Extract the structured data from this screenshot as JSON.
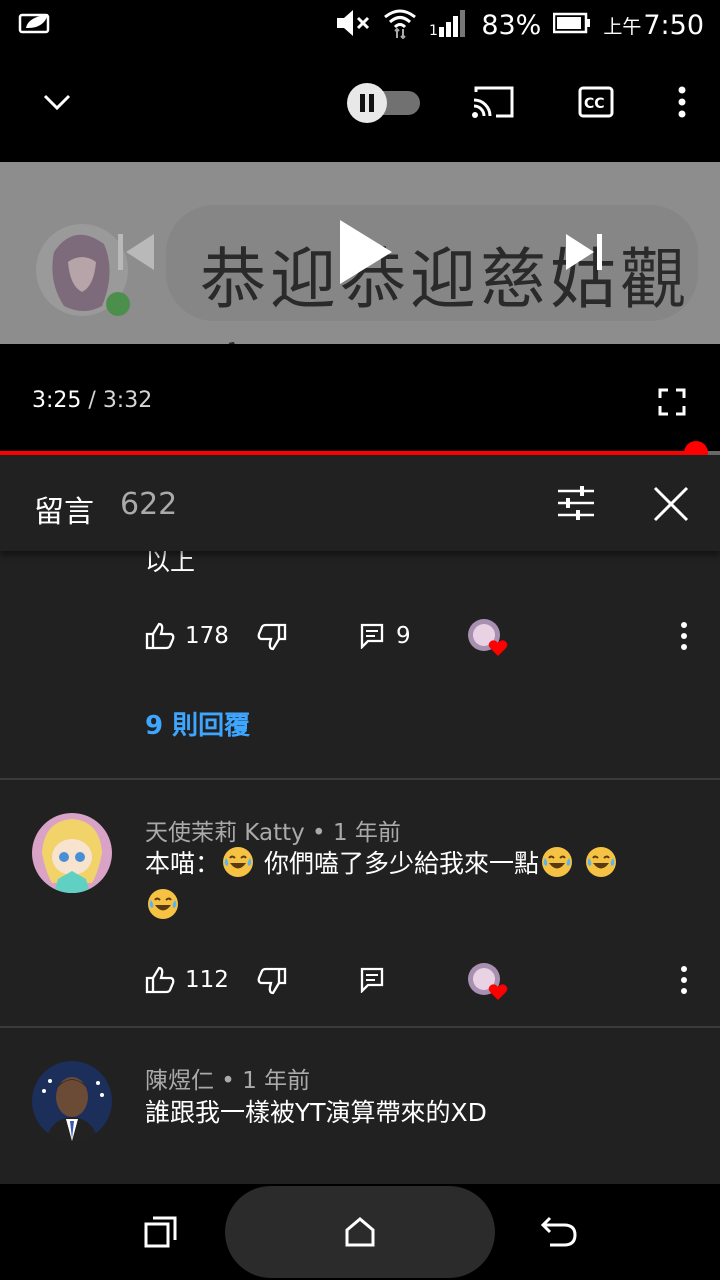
{
  "status_bar": {
    "battery_percent": "83%",
    "ampm": "上午",
    "time": "7:50"
  },
  "player": {
    "caption": "恭迎恭迎慈姑觀音",
    "current_time": "3:25",
    "separator": " / ",
    "duration": "3:32",
    "progress_fraction": 0.966
  },
  "comments_header": {
    "title": "留言",
    "count": "622"
  },
  "comments": [
    {
      "text_tail": "以上",
      "likes": "178",
      "replies_count": "9",
      "replies_link": "9 則回覆"
    },
    {
      "author": "天使茉莉 Katty",
      "meta_sep": " • ",
      "age": "1 年前",
      "text_part1": "本喵：",
      "text_part2": " 你們嗑了多少給我來一點",
      "likes": "112"
    },
    {
      "author": "陳煜仁",
      "meta_sep": " • ",
      "age": "1 年前",
      "text": "誰跟我一樣被YT演算帶來的XD"
    }
  ],
  "colors": {
    "accent_red": "#ff0000",
    "link_blue": "#3ea6ff",
    "panel_bg": "#212121"
  }
}
